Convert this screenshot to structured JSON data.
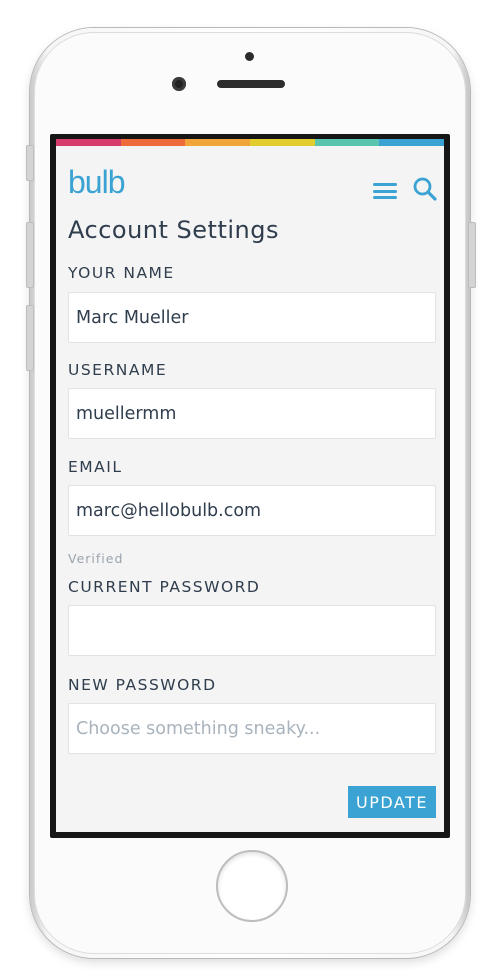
{
  "brand": {
    "logo": "bulb",
    "accent": "#3aa3d3"
  },
  "header": {
    "menu_icon": "hamburger-menu-icon",
    "search_icon": "search-icon"
  },
  "rainbow_colors": [
    "#d63c6b",
    "#ee6b3b",
    "#f0a43a",
    "#e2cd2e",
    "#59c5ae",
    "#3aa3d3"
  ],
  "page": {
    "title": "Account Settings"
  },
  "form": {
    "name": {
      "label": "YOUR NAME",
      "value": "Marc Mueller"
    },
    "username": {
      "label": "USERNAME",
      "value": "muellermm"
    },
    "email": {
      "label": "EMAIL",
      "value": "marc@hellobulb.com",
      "status": "Verified"
    },
    "current_password": {
      "label": "CURRENT PASSWORD",
      "value": ""
    },
    "new_password": {
      "label": "NEW PASSWORD",
      "value": "",
      "placeholder": "Choose something sneaky..."
    },
    "submit_label": "UPDATE"
  }
}
